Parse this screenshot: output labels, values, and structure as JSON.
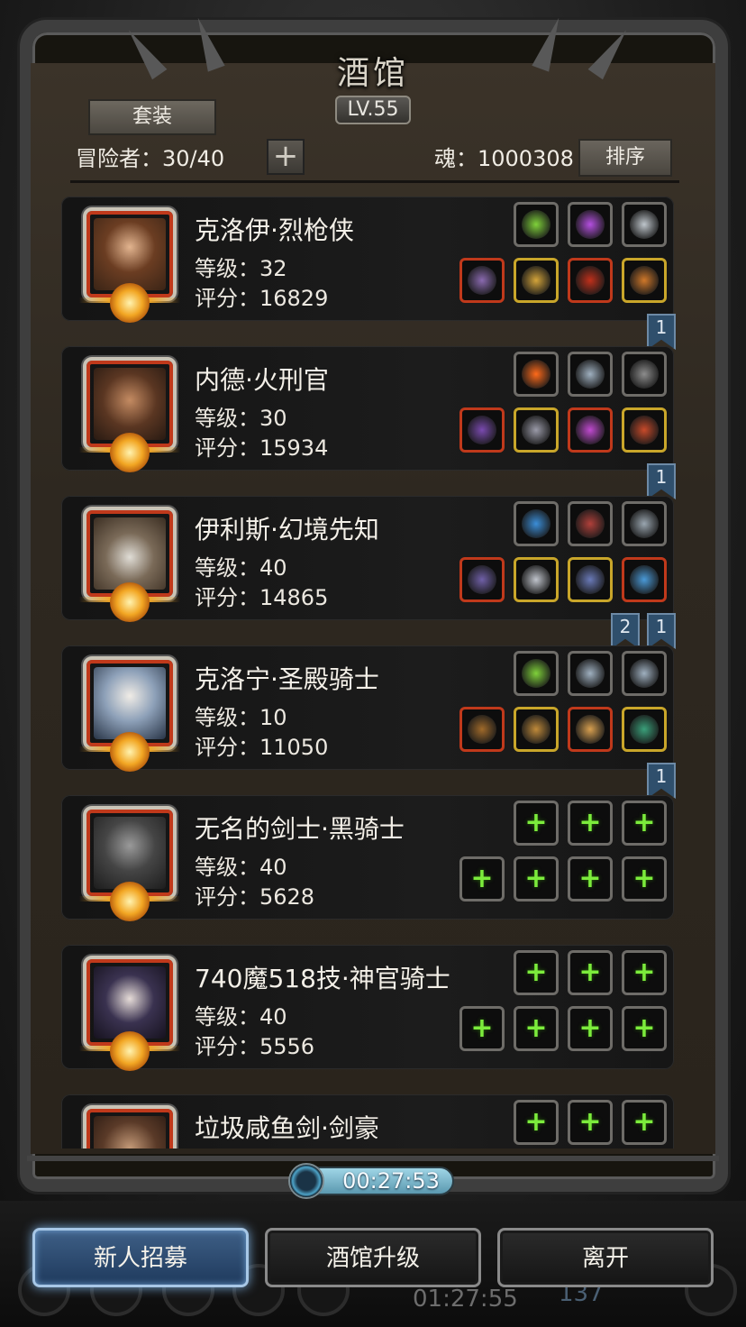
{
  "header": {
    "title": "酒馆",
    "level": "LV.55",
    "set_button": "套装",
    "adventurers": "冒险者：30/40",
    "add_symbol": "+",
    "soul": "魂：1000308",
    "sort_button": "排序"
  },
  "heroes": [
    {
      "name": "克洛伊·烈枪侠",
      "level": "等级：32",
      "score": "评分：16829",
      "bookmarks": [
        "1"
      ]
    },
    {
      "name": "内德·火刑官",
      "level": "等级：30",
      "score": "评分：15934",
      "bookmarks": [
        "1"
      ]
    },
    {
      "name": "伊利斯·幻境先知",
      "level": "等级：40",
      "score": "评分：14865",
      "bookmarks": [
        "2",
        "1"
      ]
    },
    {
      "name": "克洛宁·圣殿骑士",
      "level": "等级：10",
      "score": "评分：11050",
      "bookmarks": [
        "1"
      ]
    },
    {
      "name": "无名的剑士·黑骑士",
      "level": "等级：40",
      "score": "评分：5628",
      "bookmarks": []
    },
    {
      "name": "740魔518技·神官骑士",
      "level": "等级：40",
      "score": "评分：5556",
      "bookmarks": []
    },
    {
      "name": "垃圾咸鱼剑·剑豪",
      "level": "",
      "score": "",
      "bookmarks": []
    }
  ],
  "equip_slot_symbol": "+",
  "timer": "00:27:53",
  "footer": {
    "recruit": "新人招募",
    "upgrade": "酒馆升级",
    "leave": "离开"
  },
  "background": {
    "timer": "01:27:55",
    "count": "137"
  },
  "colors": {
    "green_plus": "#7cec3c",
    "portrait_border": "#c0391b",
    "bookmark": "#2f4f6c",
    "primary_button": "#3e5f86"
  }
}
